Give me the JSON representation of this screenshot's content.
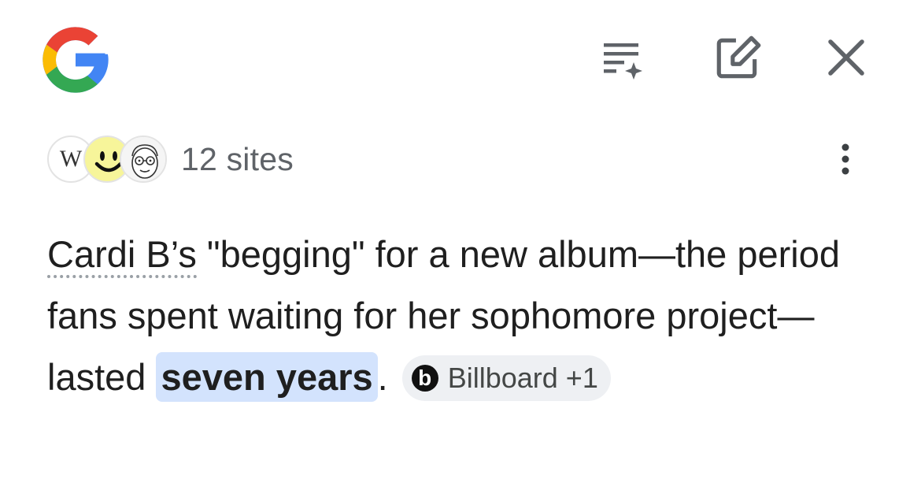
{
  "header": {
    "logo_icon": "google-g-logo",
    "actions": [
      {
        "icon": "playlist-sparkle-icon"
      },
      {
        "icon": "edit-square-icon"
      },
      {
        "icon": "close-icon"
      }
    ]
  },
  "sources": {
    "favicons": [
      {
        "icon": "wikipedia-icon",
        "letter": "W"
      },
      {
        "icon": "smiley-icon"
      },
      {
        "icon": "cartoon-face-icon"
      }
    ],
    "label": "12 sites",
    "more_icon": "more-vert-icon"
  },
  "answer": {
    "term": "Cardi B’s",
    "part1": " \"begging\" for a new album—the period fans spent waiting for her sophomore project—lasted ",
    "highlight": "seven years",
    "end": ".",
    "citation": {
      "icon_letter": "b",
      "label": "Billboard +1"
    }
  },
  "colors": {
    "highlight": "#d3e3fd",
    "chip_bg": "#eef0f3",
    "muted_text": "#5f6368",
    "icon_gray": "#5f6368"
  }
}
